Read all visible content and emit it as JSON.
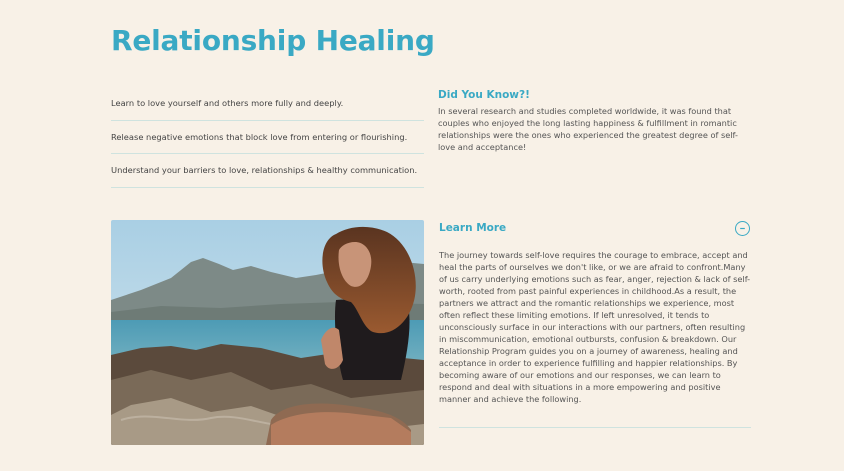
{
  "page": {
    "title": "Relationship Healing"
  },
  "benefits": [
    "Learn to love yourself and others more fully and deeply.",
    "Release negative emotions that block love from entering or flourishing.",
    "Understand your barriers to love, relationships & healthy communication."
  ],
  "did_you_know": {
    "title": "Did You Know?!",
    "body": "In several research and studies completed worldwide, it was found that couples who enjoyed the long lasting happiness & fulfillment in romantic relationships were the ones who experienced the greatest degree of self-love and acceptance!"
  },
  "learn_more": {
    "title": "Learn More",
    "toggle_icon": "minus-circle-icon",
    "expanded": true,
    "body": "The journey towards self-love requires the courage to embrace, accept and heal the parts of ourselves we don't like, or we are afraid to confront.Many of us carry underlying emotions such as fear, anger, rejection & lack of self-worth, rooted from past painful experiences in childhood.As a result, the partners we attract and the romantic relationships we experience, most often reflect these limiting emotions. If left unresolved, it tends to unconsciously surface in our interactions with our partners, often resulting in miscommunication, emotional outbursts, confusion & breakdown. Our Relationship Program guides you on a journey of awareness, healing and acceptance in order to experience fulfilling and happier relationships. By becoming aware of our emotions and our responses, we can learn to respond and deal with situations in a more empowering and positive manner and achieve the following."
  },
  "photo": {
    "subject": "woman-meditating-by-the-sea"
  },
  "colors": {
    "background": "#f8f1e7",
    "accent": "#3aa9c4",
    "divider": "#cfe3df",
    "text": "#555555"
  }
}
